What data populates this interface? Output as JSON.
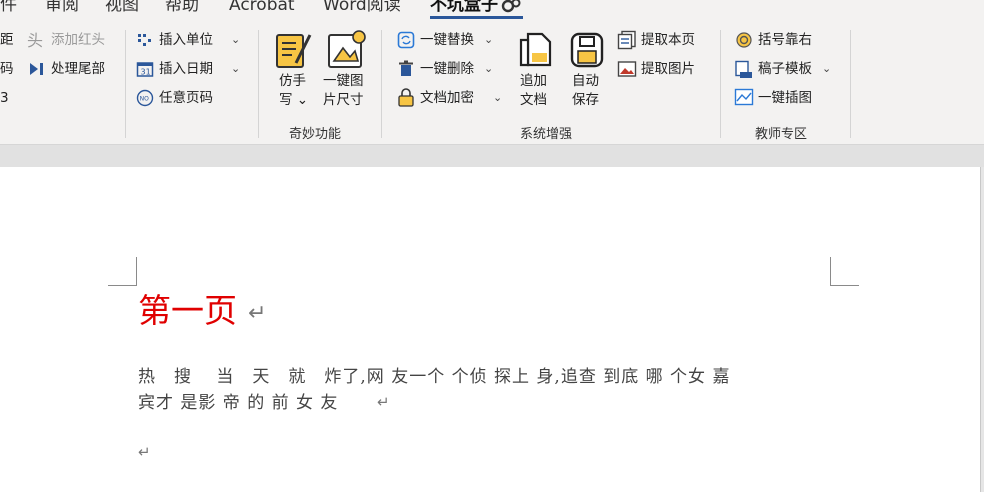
{
  "menu": {
    "tabs": [
      "件",
      "审阅",
      "视图",
      "帮助",
      "Acrobat",
      "Word阅读",
      "不坑盒子"
    ],
    "active_tab": "不坑盒子"
  },
  "ribbon": {
    "col1": [
      "距",
      "码",
      "3"
    ],
    "col2": {
      "add_header": "添加红头",
      "process_tail": "处理尾部"
    },
    "col3": {
      "insert_unit": "插入单位",
      "insert_date": "插入日期",
      "any_page_number": "任意页码"
    },
    "group_magic": {
      "label": "奇妙功能",
      "imitate_handwriting": "仿手写",
      "one_click_image_size": "一键图片尺寸"
    },
    "group_system": {
      "label": "系统增强",
      "one_click_replace": "一键替换",
      "one_click_delete": "一键删除",
      "doc_encrypt": "文档加密",
      "append_doc": "追加文档",
      "auto_save": "自动保存",
      "extract_page": "提取本页",
      "extract_images": "提取图片"
    },
    "group_teacher": {
      "label": "教师专区",
      "bracket_right": "括号靠右",
      "paper_template": "稿子模板",
      "one_click_illustration": "一键插图"
    }
  },
  "document": {
    "heading": "第一页",
    "line1": "热　搜　 当　天　就　炸了,网 友一个 个侦 探上 身,追查 到底 哪 个女 嘉",
    "line2": "宾才 是影 帝 的 前 女 友",
    "pilcrow": "↵"
  }
}
